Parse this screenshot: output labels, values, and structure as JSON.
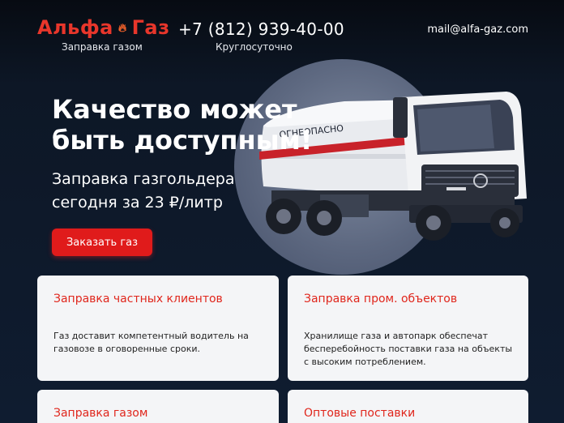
{
  "header": {
    "logo_part1": "Альфа",
    "logo_part2": "Газ",
    "logo_tagline": "Заправка газом",
    "phone": "+7 (812) 939-40-00",
    "phone_note": "Круглосуточно",
    "email": "mail@alfa-gaz.com"
  },
  "hero": {
    "title": "Качество может быть доступным!",
    "subtitle": "Заправка газгольдера сегодня за 23 ₽/литр",
    "order_button": "Заказать газ",
    "truck_tank_text": "ОГНЕОПАСНО"
  },
  "cards": [
    {
      "title": "Заправка частных клиентов",
      "text": "Газ доставит компетентный водитель на газовозе в оговоренные сроки."
    },
    {
      "title": "Заправка пром. объектов",
      "text": "Хранилище газа и автопарк обеспечат бесперебойность поставки газа на объекты с высоким потреблением."
    },
    {
      "title": "Заправка газом",
      "text": ""
    },
    {
      "title": "Оптовые поставки",
      "text": ""
    }
  ],
  "colors": {
    "accent": "#e8362b",
    "button": "#e01b1b",
    "background": "#0f1a2b",
    "card": "#f4f5f7"
  }
}
